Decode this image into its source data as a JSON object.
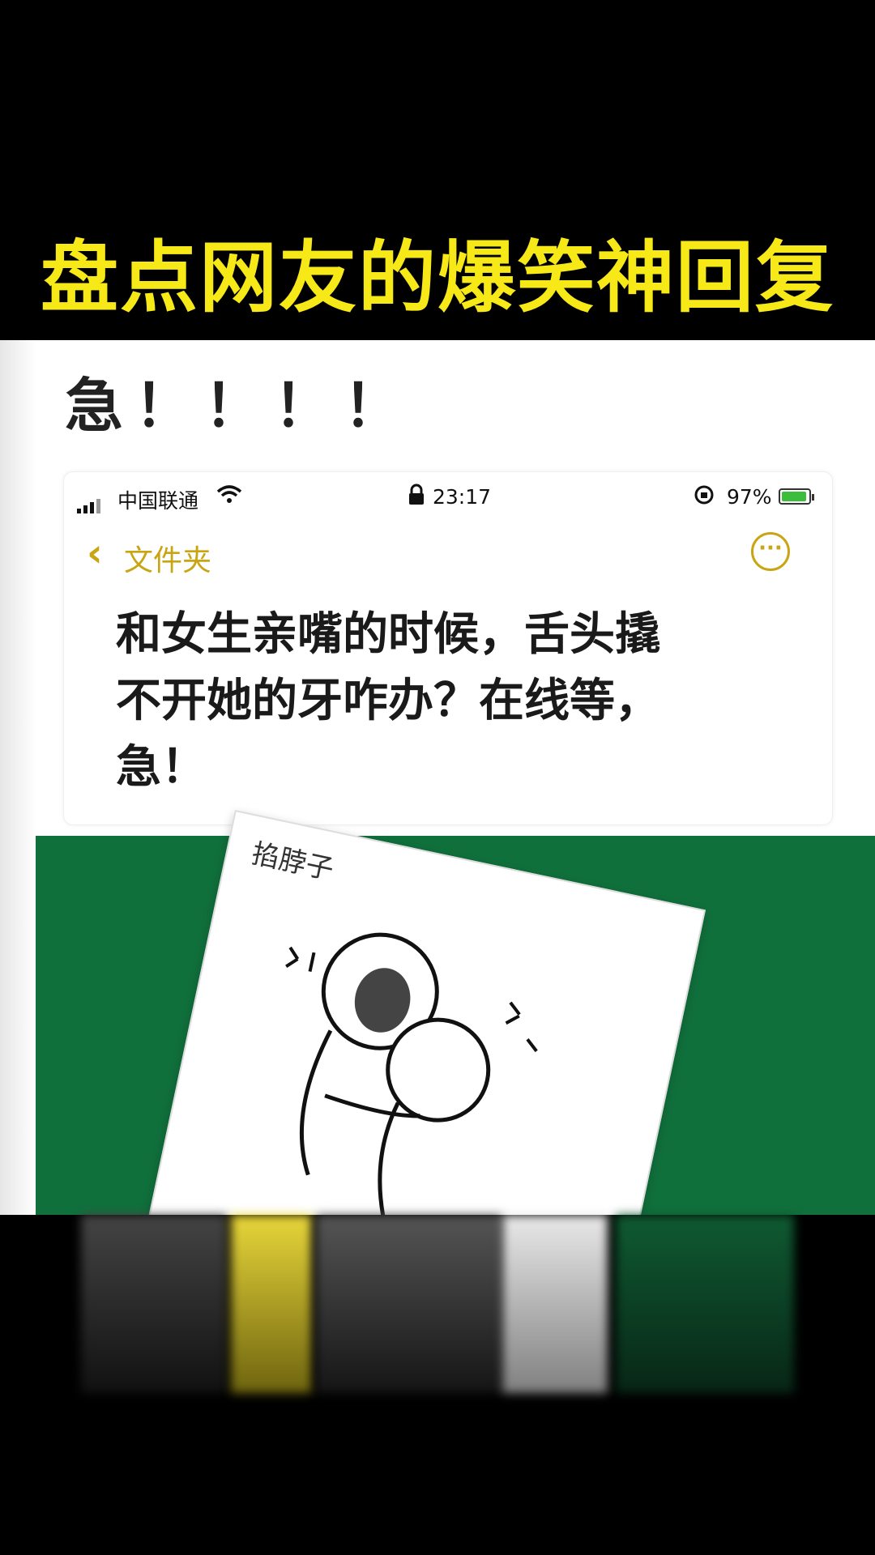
{
  "headline": "盘点网友的爆笑神回复",
  "top_exclaim": "急！！！！",
  "status_bar": {
    "carrier": "中国联通",
    "time": "23:17",
    "battery": "97%"
  },
  "nav": {
    "back_label": "文件夹",
    "more_label": "···"
  },
  "note": {
    "line1": "和女生亲嘴的时候，舌头撬",
    "line2": "不开她的牙咋办？在线等，",
    "line3": "急！"
  },
  "meme": {
    "caption": "掐脖子"
  },
  "colors": {
    "headline": "#f7e818",
    "accent": "#c9a514",
    "green_panel": "#10703c"
  }
}
